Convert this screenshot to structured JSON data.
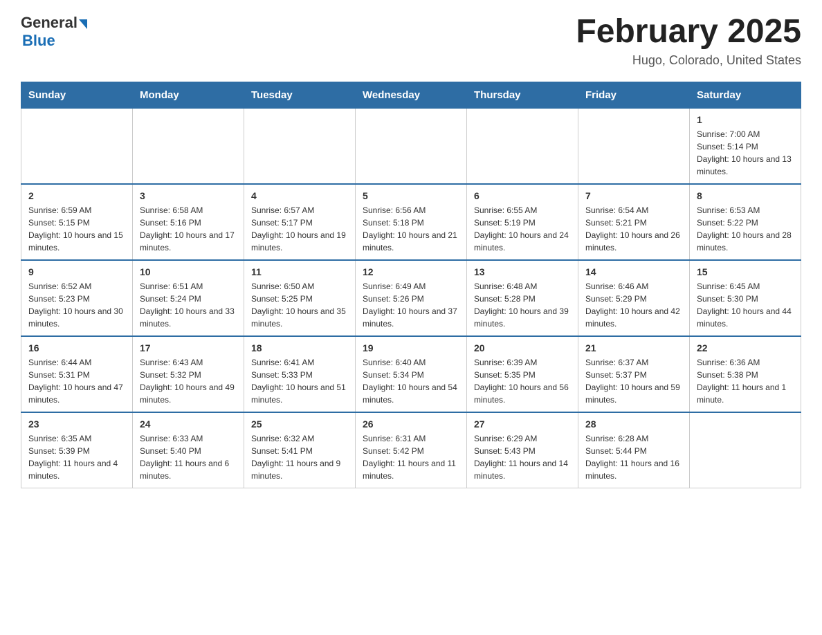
{
  "header": {
    "logo_general": "General",
    "logo_blue": "Blue",
    "month_title": "February 2025",
    "location": "Hugo, Colorado, United States"
  },
  "weekdays": [
    "Sunday",
    "Monday",
    "Tuesday",
    "Wednesday",
    "Thursday",
    "Friday",
    "Saturday"
  ],
  "weeks": [
    [
      {
        "day": "",
        "sunrise": "",
        "sunset": "",
        "daylight": ""
      },
      {
        "day": "",
        "sunrise": "",
        "sunset": "",
        "daylight": ""
      },
      {
        "day": "",
        "sunrise": "",
        "sunset": "",
        "daylight": ""
      },
      {
        "day": "",
        "sunrise": "",
        "sunset": "",
        "daylight": ""
      },
      {
        "day": "",
        "sunrise": "",
        "sunset": "",
        "daylight": ""
      },
      {
        "day": "",
        "sunrise": "",
        "sunset": "",
        "daylight": ""
      },
      {
        "day": "1",
        "sunrise": "Sunrise: 7:00 AM",
        "sunset": "Sunset: 5:14 PM",
        "daylight": "Daylight: 10 hours and 13 minutes."
      }
    ],
    [
      {
        "day": "2",
        "sunrise": "Sunrise: 6:59 AM",
        "sunset": "Sunset: 5:15 PM",
        "daylight": "Daylight: 10 hours and 15 minutes."
      },
      {
        "day": "3",
        "sunrise": "Sunrise: 6:58 AM",
        "sunset": "Sunset: 5:16 PM",
        "daylight": "Daylight: 10 hours and 17 minutes."
      },
      {
        "day": "4",
        "sunrise": "Sunrise: 6:57 AM",
        "sunset": "Sunset: 5:17 PM",
        "daylight": "Daylight: 10 hours and 19 minutes."
      },
      {
        "day": "5",
        "sunrise": "Sunrise: 6:56 AM",
        "sunset": "Sunset: 5:18 PM",
        "daylight": "Daylight: 10 hours and 21 minutes."
      },
      {
        "day": "6",
        "sunrise": "Sunrise: 6:55 AM",
        "sunset": "Sunset: 5:19 PM",
        "daylight": "Daylight: 10 hours and 24 minutes."
      },
      {
        "day": "7",
        "sunrise": "Sunrise: 6:54 AM",
        "sunset": "Sunset: 5:21 PM",
        "daylight": "Daylight: 10 hours and 26 minutes."
      },
      {
        "day": "8",
        "sunrise": "Sunrise: 6:53 AM",
        "sunset": "Sunset: 5:22 PM",
        "daylight": "Daylight: 10 hours and 28 minutes."
      }
    ],
    [
      {
        "day": "9",
        "sunrise": "Sunrise: 6:52 AM",
        "sunset": "Sunset: 5:23 PM",
        "daylight": "Daylight: 10 hours and 30 minutes."
      },
      {
        "day": "10",
        "sunrise": "Sunrise: 6:51 AM",
        "sunset": "Sunset: 5:24 PM",
        "daylight": "Daylight: 10 hours and 33 minutes."
      },
      {
        "day": "11",
        "sunrise": "Sunrise: 6:50 AM",
        "sunset": "Sunset: 5:25 PM",
        "daylight": "Daylight: 10 hours and 35 minutes."
      },
      {
        "day": "12",
        "sunrise": "Sunrise: 6:49 AM",
        "sunset": "Sunset: 5:26 PM",
        "daylight": "Daylight: 10 hours and 37 minutes."
      },
      {
        "day": "13",
        "sunrise": "Sunrise: 6:48 AM",
        "sunset": "Sunset: 5:28 PM",
        "daylight": "Daylight: 10 hours and 39 minutes."
      },
      {
        "day": "14",
        "sunrise": "Sunrise: 6:46 AM",
        "sunset": "Sunset: 5:29 PM",
        "daylight": "Daylight: 10 hours and 42 minutes."
      },
      {
        "day": "15",
        "sunrise": "Sunrise: 6:45 AM",
        "sunset": "Sunset: 5:30 PM",
        "daylight": "Daylight: 10 hours and 44 minutes."
      }
    ],
    [
      {
        "day": "16",
        "sunrise": "Sunrise: 6:44 AM",
        "sunset": "Sunset: 5:31 PM",
        "daylight": "Daylight: 10 hours and 47 minutes."
      },
      {
        "day": "17",
        "sunrise": "Sunrise: 6:43 AM",
        "sunset": "Sunset: 5:32 PM",
        "daylight": "Daylight: 10 hours and 49 minutes."
      },
      {
        "day": "18",
        "sunrise": "Sunrise: 6:41 AM",
        "sunset": "Sunset: 5:33 PM",
        "daylight": "Daylight: 10 hours and 51 minutes."
      },
      {
        "day": "19",
        "sunrise": "Sunrise: 6:40 AM",
        "sunset": "Sunset: 5:34 PM",
        "daylight": "Daylight: 10 hours and 54 minutes."
      },
      {
        "day": "20",
        "sunrise": "Sunrise: 6:39 AM",
        "sunset": "Sunset: 5:35 PM",
        "daylight": "Daylight: 10 hours and 56 minutes."
      },
      {
        "day": "21",
        "sunrise": "Sunrise: 6:37 AM",
        "sunset": "Sunset: 5:37 PM",
        "daylight": "Daylight: 10 hours and 59 minutes."
      },
      {
        "day": "22",
        "sunrise": "Sunrise: 6:36 AM",
        "sunset": "Sunset: 5:38 PM",
        "daylight": "Daylight: 11 hours and 1 minute."
      }
    ],
    [
      {
        "day": "23",
        "sunrise": "Sunrise: 6:35 AM",
        "sunset": "Sunset: 5:39 PM",
        "daylight": "Daylight: 11 hours and 4 minutes."
      },
      {
        "day": "24",
        "sunrise": "Sunrise: 6:33 AM",
        "sunset": "Sunset: 5:40 PM",
        "daylight": "Daylight: 11 hours and 6 minutes."
      },
      {
        "day": "25",
        "sunrise": "Sunrise: 6:32 AM",
        "sunset": "Sunset: 5:41 PM",
        "daylight": "Daylight: 11 hours and 9 minutes."
      },
      {
        "day": "26",
        "sunrise": "Sunrise: 6:31 AM",
        "sunset": "Sunset: 5:42 PM",
        "daylight": "Daylight: 11 hours and 11 minutes."
      },
      {
        "day": "27",
        "sunrise": "Sunrise: 6:29 AM",
        "sunset": "Sunset: 5:43 PM",
        "daylight": "Daylight: 11 hours and 14 minutes."
      },
      {
        "day": "28",
        "sunrise": "Sunrise: 6:28 AM",
        "sunset": "Sunset: 5:44 PM",
        "daylight": "Daylight: 11 hours and 16 minutes."
      },
      {
        "day": "",
        "sunrise": "",
        "sunset": "",
        "daylight": ""
      }
    ]
  ]
}
